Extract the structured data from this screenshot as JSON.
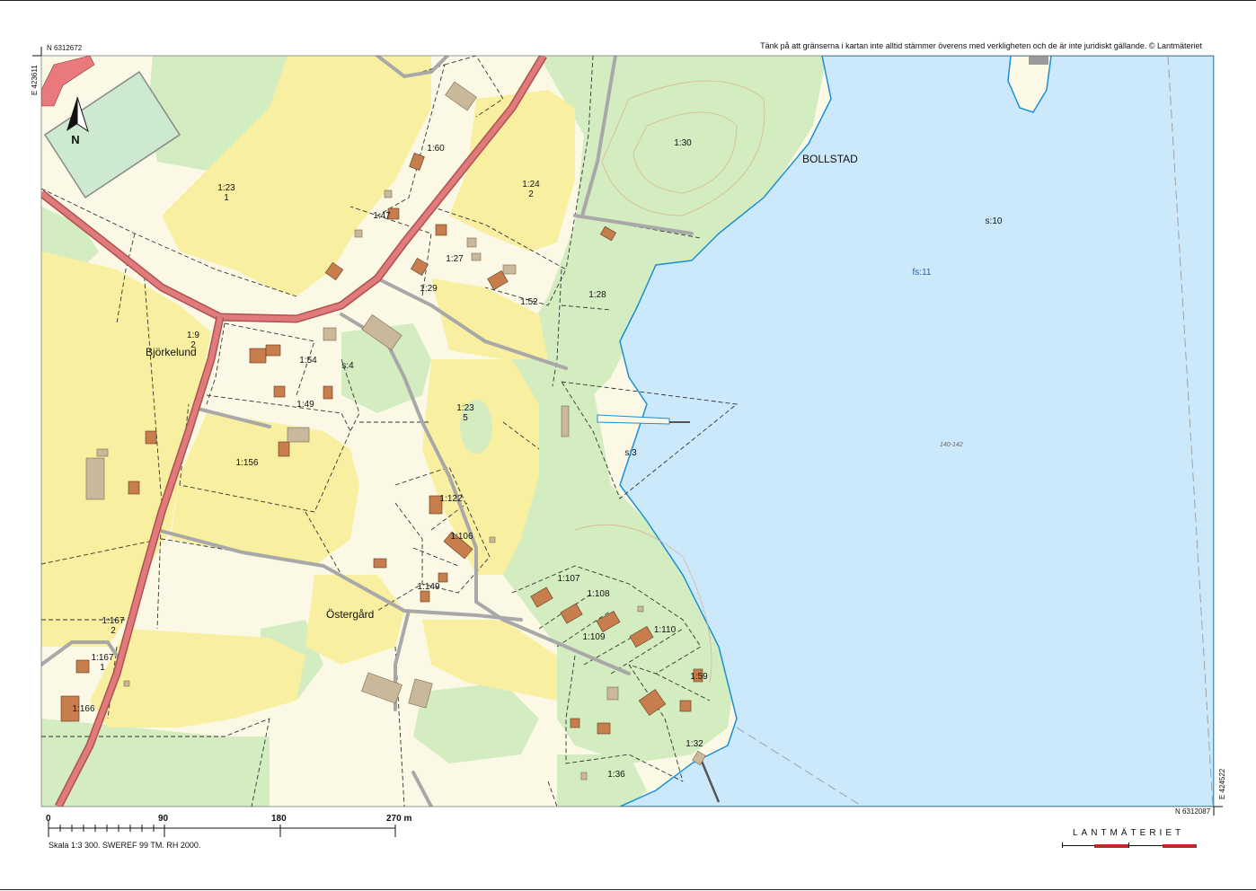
{
  "header": {
    "disclaimer": "Tänk på att gränserna i kartan inte alltid stämmer överens med verkligheten och de är inte juridiskt gällande. © Lantmäteriet"
  },
  "coords": {
    "top_left_n": "N 6312672",
    "top_left_e": "E 423611",
    "bottom_right_n": "N 6312087",
    "bottom_right_e": "E 424522"
  },
  "north": "N",
  "places": {
    "bollstad": "BOLLSTAD",
    "bjorkelund": "Björkelund",
    "ostergard": "Östergård"
  },
  "parcels": [
    "1:23\n1",
    "1:24\n2",
    "1:30",
    "1:60",
    "1:47",
    "1:27",
    "1:29",
    "1:52",
    "1:28",
    "1:9\n2",
    "1:54",
    "s:4",
    "1:49",
    "1:156",
    "1:23\n5",
    "s:3",
    "s:10",
    "fs:11",
    "1:122",
    "1:106",
    "1:149",
    "1:107",
    "1:108",
    "1:109",
    "1:110",
    "1:167\n2",
    "1:167\n1",
    "1:166",
    "1:59",
    "1:32",
    "1:36"
  ],
  "depth": "140-142",
  "scale": {
    "ticks": [
      "0",
      "90",
      "180",
      "270 m"
    ],
    "note": "Skala 1:3 300. SWEREF 99 TM. RH 2000."
  },
  "brand": "LANTMÄTERIET",
  "colors": {
    "water": "#cbe9fb",
    "shore": "#1a8fd6",
    "forest": "#d3ecc0",
    "field": "#f8f0a0",
    "open": "#fbf9e6",
    "road": "#e07b7b",
    "building": "#c87d4c",
    "building_other": "#c9b89a"
  }
}
